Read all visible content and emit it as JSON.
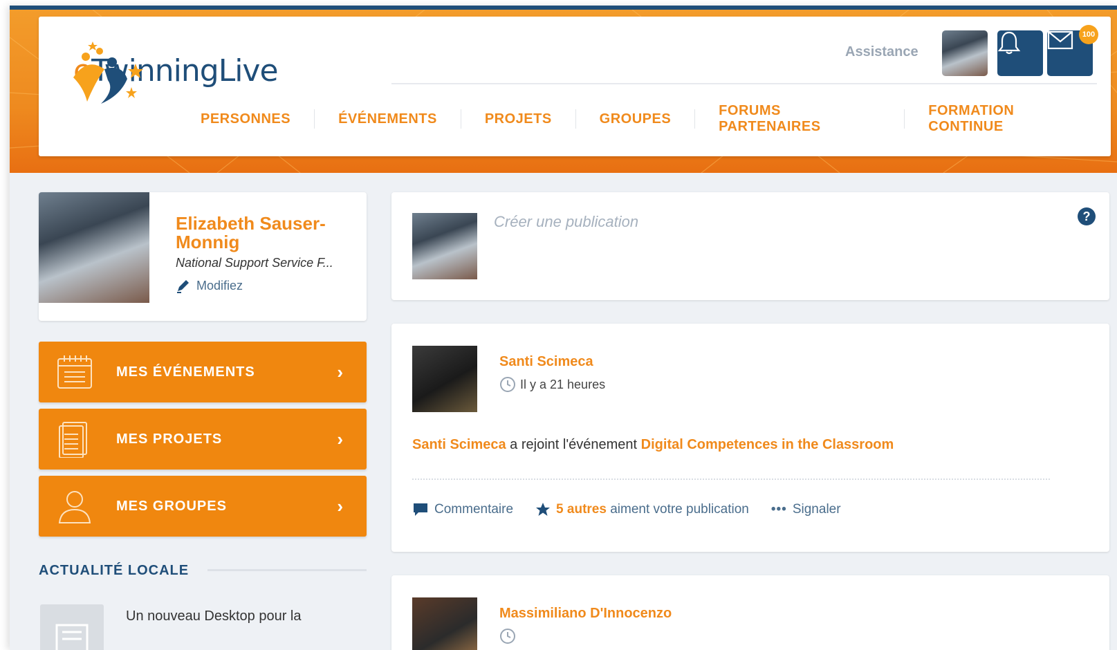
{
  "header": {
    "logo_text_e": "e",
    "logo_text_rest": "TwinningLive",
    "assistance_link": "Assistance",
    "notification_badge": "100",
    "nav": [
      "PERSONNES",
      "ÉVÉNEMENTS",
      "PROJETS",
      "GROUPES",
      "FORUMS PARTENAIRES",
      "FORMATION CONTINUE"
    ]
  },
  "profile": {
    "name": "Elizabeth Sauser-Monnig",
    "organization": "National Support Service F...",
    "edit_label": "Modifiez"
  },
  "sidebar_menu": [
    {
      "label": "MES ÉVÉNEMENTS",
      "icon": "calendar-icon"
    },
    {
      "label": "MES PROJETS",
      "icon": "document-icon"
    },
    {
      "label": "MES GROUPES",
      "icon": "user-icon"
    }
  ],
  "local_news": {
    "title": "ACTUALITÉ LOCALE",
    "item_text": "Un nouveau Desktop pour la"
  },
  "compose": {
    "placeholder": "Créer une publication"
  },
  "posts": [
    {
      "author": "Santi Scimeca",
      "time": "Il y a 21 heures",
      "body_actor": "Santi Scimeca",
      "body_verb": " a rejoint l'événement ",
      "body_event": "Digital Competences in the Classroom",
      "comment_label": "Commentaire",
      "likes_highlight": "5 autres",
      "likes_rest": " aiment votre publication",
      "report_label": "Signaler"
    },
    {
      "author": "Massimiliano D'Innocenzo"
    }
  ],
  "colors": {
    "brand_orange": "#f08a1c",
    "brand_blue": "#1f4e79"
  }
}
